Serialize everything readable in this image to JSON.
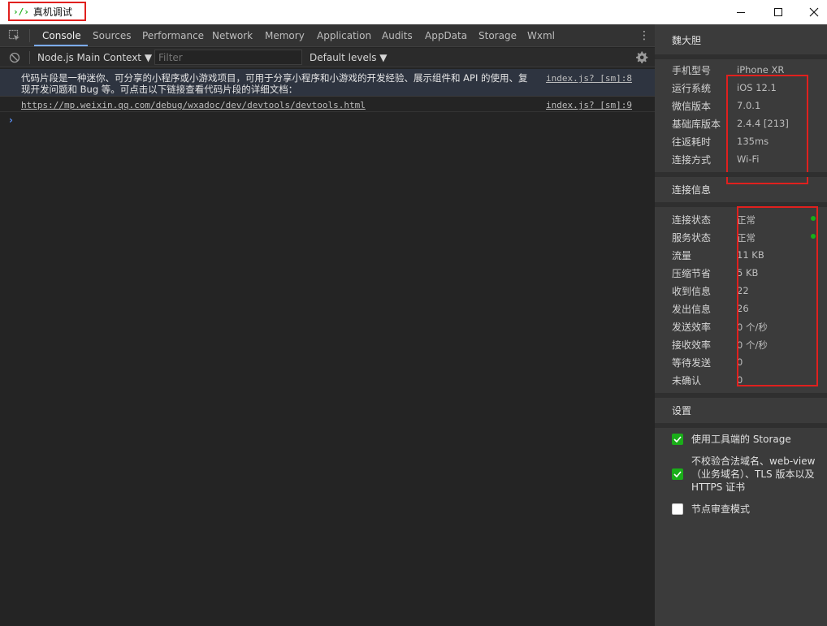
{
  "window": {
    "logo": "›/›",
    "title": "真机调试"
  },
  "tabs": [
    "Console",
    "Sources",
    "Performance",
    "Network",
    "Memory",
    "Application",
    "Audits",
    "AppData",
    "Storage",
    "Wxml"
  ],
  "toolbar": {
    "context": "Node.js Main Context ▼",
    "filter_placeholder": "Filter",
    "levels": "Default levels ▼"
  },
  "console": {
    "messages": [
      {
        "text": "代码片段是一种迷你、可分享的小程序或小游戏项目，可用于分享小程序和小游戏的开发经验、展示组件和 API 的使用、复现开发问题和 Bug 等。可点击以下链接查看代码片段的详细文档：",
        "source": "index.js? [sm]:8"
      },
      {
        "text": "https://mp.weixin.qq.com/debug/wxadoc/dev/devtools/devtools.html",
        "source": "index.js? [sm]:9"
      }
    ],
    "prompt": "›"
  },
  "panel": {
    "user": "魏大胆",
    "device": [
      {
        "label": "手机型号",
        "value": "iPhone XR"
      },
      {
        "label": "运行系统",
        "value": "iOS 12.1"
      },
      {
        "label": "微信版本",
        "value": "7.0.1"
      },
      {
        "label": "基础库版本",
        "value": "2.4.4 [213]"
      },
      {
        "label": "往返耗时",
        "value": "135ms"
      },
      {
        "label": "连接方式",
        "value": "Wi-Fi"
      }
    ],
    "conn_header": "连接信息",
    "conn": [
      {
        "label": "连接状态",
        "value": "正常"
      },
      {
        "label": "服务状态",
        "value": "正常"
      },
      {
        "label": "流量",
        "value": "11 KB"
      },
      {
        "label": "压缩节省",
        "value": "5 KB"
      },
      {
        "label": "收到信息",
        "value": "22"
      },
      {
        "label": "发出信息",
        "value": "26"
      },
      {
        "label": "发送效率",
        "value": "0 个/秒"
      },
      {
        "label": "接收效率",
        "value": "0 个/秒"
      },
      {
        "label": "等待发送",
        "value": "0"
      },
      {
        "label": "未确认",
        "value": "0"
      }
    ],
    "settings_header": "设置",
    "settings": [
      {
        "label": "使用工具端的 Storage",
        "checked": true
      },
      {
        "label": "不校验合法域名、web-view（业务域名）、TLS 版本以及 HTTPS 证书",
        "checked": true
      },
      {
        "label": "节点审查模式",
        "checked": false
      }
    ]
  },
  "colors": {
    "accent_green": "#1aad19",
    "annotation_red": "#e0201e",
    "tab_active_underline": "#7cacf8"
  }
}
